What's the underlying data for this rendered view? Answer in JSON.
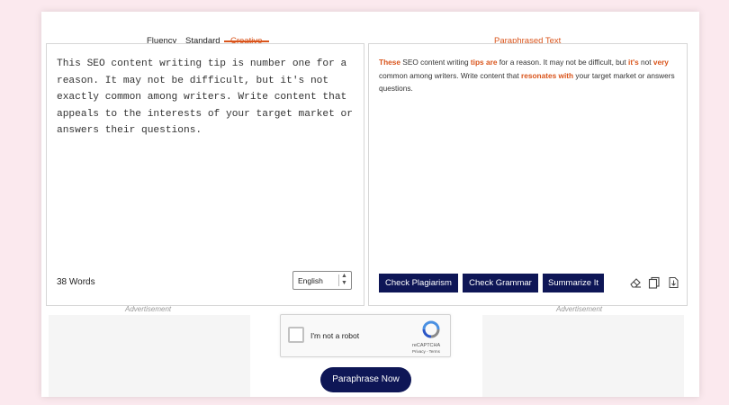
{
  "modes": {
    "tabs": [
      {
        "label": "Fluency"
      },
      {
        "label": "Standard"
      },
      {
        "label": "Creative"
      }
    ],
    "active": "Creative"
  },
  "output_tab": {
    "label": "Paraphrased Text"
  },
  "input": {
    "text": "This SEO content writing tip is number one for a reason. It may not be difficult, but it's not exactly common among writers. Write content that appeals to the interests of your target market or answers their questions.",
    "word_count": "38 Words",
    "language": "English"
  },
  "output": {
    "segments": [
      {
        "text": "These",
        "highlight": true
      },
      {
        "text": " SEO content writing ",
        "highlight": false
      },
      {
        "text": "tips are",
        "highlight": true
      },
      {
        "text": " for a reason. It may not be difficult, but ",
        "highlight": false
      },
      {
        "text": "it's",
        "highlight": true
      },
      {
        "text": " not ",
        "highlight": false
      },
      {
        "text": "very",
        "highlight": true
      },
      {
        "text": " common among writers. Write content that ",
        "highlight": false
      },
      {
        "text": "resonates with",
        "highlight": true
      },
      {
        "text": " your target market or answers  questions.",
        "highlight": false
      }
    ],
    "highlight_color": "#d9541b"
  },
  "actions": {
    "check_plagiarism": "Check Plagiarism",
    "check_grammar": "Check Grammar",
    "summarize": "Summarize It",
    "button_color": "#0e1656"
  },
  "tools": [
    {
      "icon": "eraser-icon"
    },
    {
      "icon": "copy-icon"
    },
    {
      "icon": "download-icon"
    }
  ],
  "ads": {
    "left_label": "Advertisement",
    "right_label": "Advertisement"
  },
  "captcha": {
    "label": "I'm not a robot",
    "brand": "reCAPTCHA",
    "terms": "Privacy - Terms"
  },
  "submit": {
    "label": "Paraphrase Now"
  }
}
